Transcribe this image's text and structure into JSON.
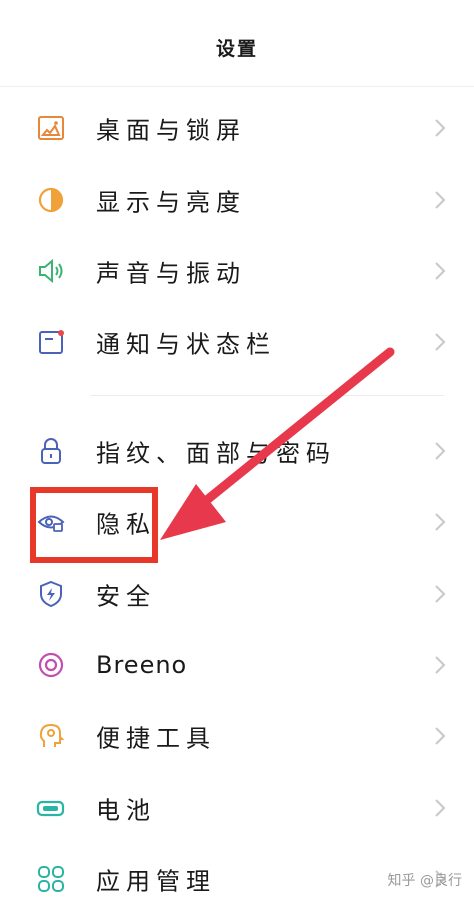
{
  "header": {
    "title": "设置"
  },
  "settings": [
    {
      "label": "桌面与锁屏",
      "icon": "wallpaper-icon"
    },
    {
      "label": "显示与亮度",
      "icon": "brightness-icon"
    },
    {
      "label": "声音与振动",
      "icon": "speaker-icon"
    },
    {
      "label": "通知与状态栏",
      "icon": "notification-icon"
    },
    {
      "label": "指纹、面部与密码",
      "icon": "lock-icon"
    },
    {
      "label": "隐私",
      "icon": "privacy-eye-icon"
    },
    {
      "label": "安全",
      "icon": "shield-icon"
    },
    {
      "label": "Breeno",
      "icon": "breeno-icon"
    },
    {
      "label": "便捷工具",
      "icon": "tools-head-icon"
    },
    {
      "label": "电池",
      "icon": "battery-icon"
    },
    {
      "label": "应用管理",
      "icon": "apps-icon"
    }
  ],
  "watermark": "知乎 @良行",
  "colors": {
    "highlight": "#e8382a",
    "arrow": "#e8384c"
  }
}
